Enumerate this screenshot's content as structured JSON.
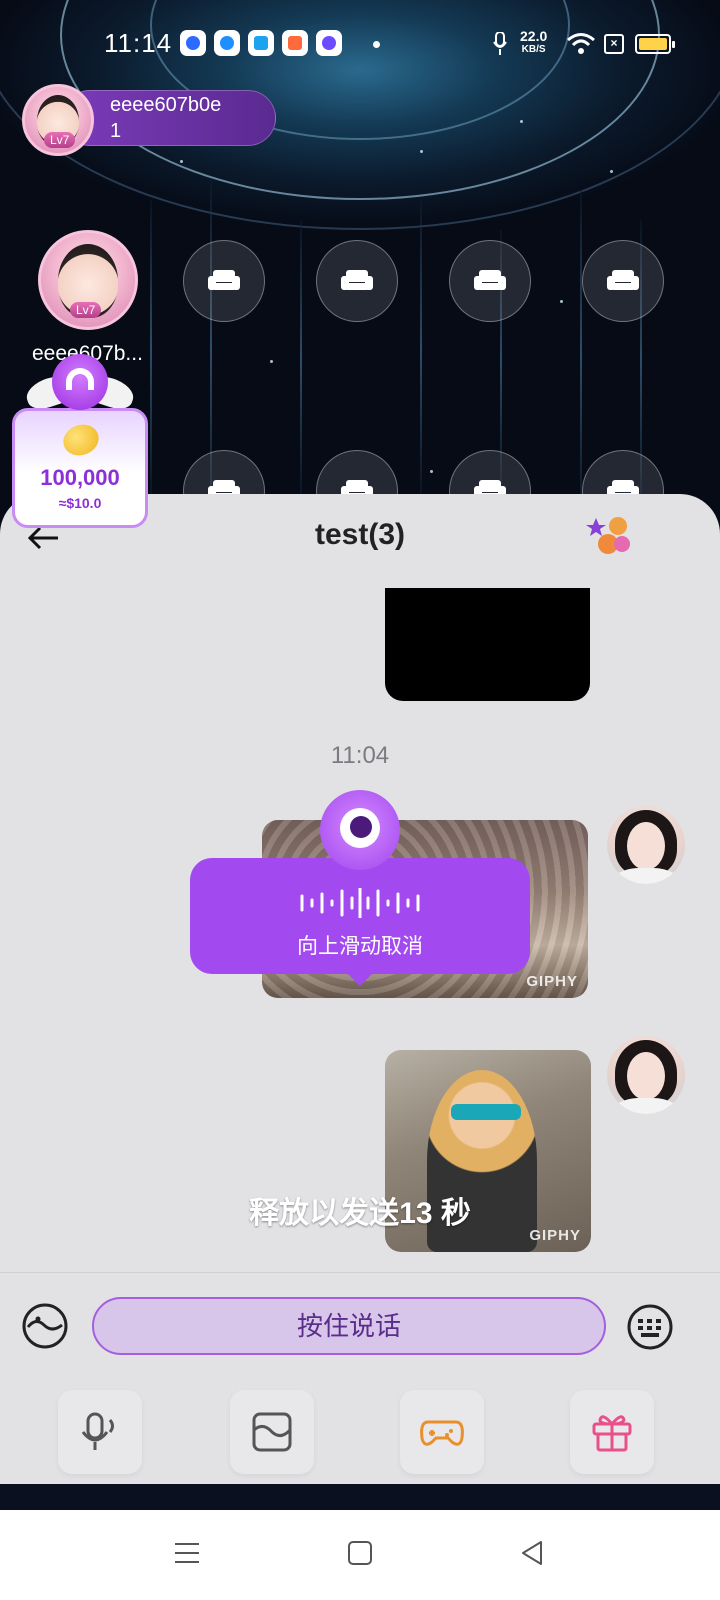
{
  "status_bar": {
    "time": "11:14",
    "net_speed_value": "22.0",
    "net_speed_unit": "KB/S",
    "icons": [
      "baidu-app-icon",
      "blue-circle-app-icon",
      "qq-browser-icon",
      "game-app-icon",
      "purple-app-icon",
      "notification-dot",
      "microphone-icon",
      "wifi-icon",
      "sim-icon",
      "battery-icon"
    ],
    "battery_color": "#ffd24a"
  },
  "room": {
    "host": {
      "name": "eeee607b0e",
      "count": "1",
      "level": "Lv7"
    },
    "owner_seat": {
      "name": "eeee607b...",
      "level": "Lv7"
    },
    "coin_card": {
      "amount": "100,000",
      "usd": "≈$10.0"
    }
  },
  "chat": {
    "title": "test(3)",
    "timestamp": "11:04",
    "giphy_label": "GIPHY",
    "release_hint": "释放以发送13 秒",
    "hold_to_talk": "按住说话"
  },
  "recording": {
    "cancel_hint": "向上滑动取消"
  },
  "colors": {
    "accent": "#a24af0",
    "accent_dark": "#8d2fd8",
    "sheet_bg": "#e2e2e5"
  }
}
